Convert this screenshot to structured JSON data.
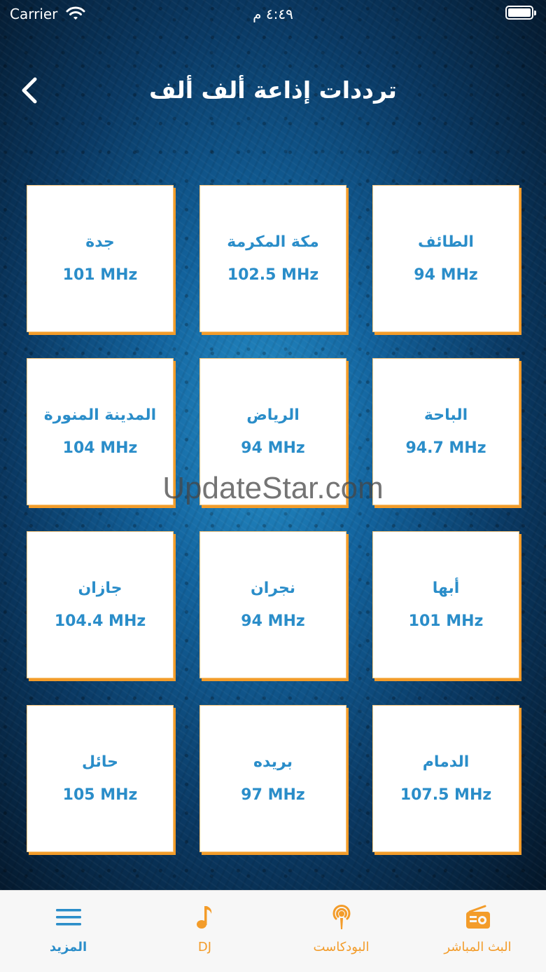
{
  "status_bar": {
    "carrier": "Carrier",
    "time": "٤:٤٩ م"
  },
  "header": {
    "title": "ترددات إذاعة ألف ألف"
  },
  "stations": [
    {
      "city": "جدة",
      "frequency": "101 MHz"
    },
    {
      "city": "مكة المكرمة",
      "frequency": "102.5 MHz"
    },
    {
      "city": "الطائف",
      "frequency": "94 MHz"
    },
    {
      "city": "المدينة المنورة",
      "frequency": "104 MHz"
    },
    {
      "city": "الرياض",
      "frequency": "94 MHz"
    },
    {
      "city": "الباحة",
      "frequency": "94.7 MHz"
    },
    {
      "city": "جازان",
      "frequency": "104.4 MHz"
    },
    {
      "city": "نجران",
      "frequency": "94 MHz"
    },
    {
      "city": "أبها",
      "frequency": "101 MHz"
    },
    {
      "city": "حائل",
      "frequency": "105 MHz"
    },
    {
      "city": "بريده",
      "frequency": "97 MHz"
    },
    {
      "city": "الدمام",
      "frequency": "107.5 MHz"
    }
  ],
  "watermark": "UpdateStar.com",
  "tab_bar": {
    "tabs": [
      {
        "label": "المزيد",
        "icon": "menu-icon",
        "active": true
      },
      {
        "label": "DJ",
        "icon": "music-note-icon",
        "active": false
      },
      {
        "label": "البودكاست",
        "icon": "podcast-icon",
        "active": false
      },
      {
        "label": "البث المباشر",
        "icon": "radio-icon",
        "active": false
      }
    ]
  },
  "colors": {
    "accent_blue": "#2a8dc9",
    "accent_orange": "#f39c2a"
  }
}
